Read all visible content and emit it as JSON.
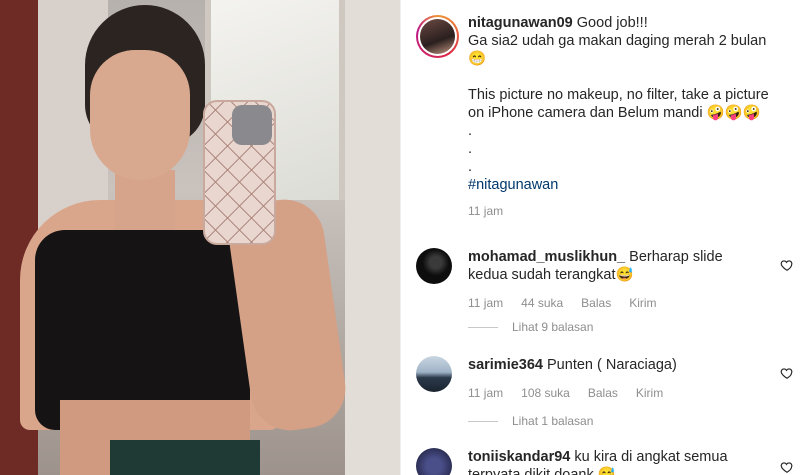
{
  "post": {
    "username": "nitagunawan09",
    "caption": "Good job!!!\nGa sia2 udah ga makan daging merah 2 bulan 😁\n\nThis picture no makeup, no filter, take a picture on iPhone camera dan Belum mandi 🤪🤪🤪\n.\n.\n.",
    "hashtag": "#nitagunawan",
    "time": "11 jam"
  },
  "comments": [
    {
      "username": "mohamad_muslikhun_",
      "text": "Berharap slide kedua sudah terangkat😅",
      "time": "11 jam",
      "likes": "44 suka",
      "reply_label": "Balas",
      "send_label": "Kirim",
      "view_replies": "Lihat 9 balasan"
    },
    {
      "username": "sarimie364",
      "text": "Punten ( Naraciaga)",
      "time": "11 jam",
      "likes": "108 suka",
      "reply_label": "Balas",
      "send_label": "Kirim",
      "view_replies": "Lihat 1 balasan"
    },
    {
      "username": "toniiskandar94",
      "text": "ku kira di angkat semua terpyata dikit doank 😅"
    }
  ],
  "icons": {
    "like": "heart-icon"
  },
  "colors": {
    "link": "#00376b",
    "muted": "#8e8e8e"
  }
}
